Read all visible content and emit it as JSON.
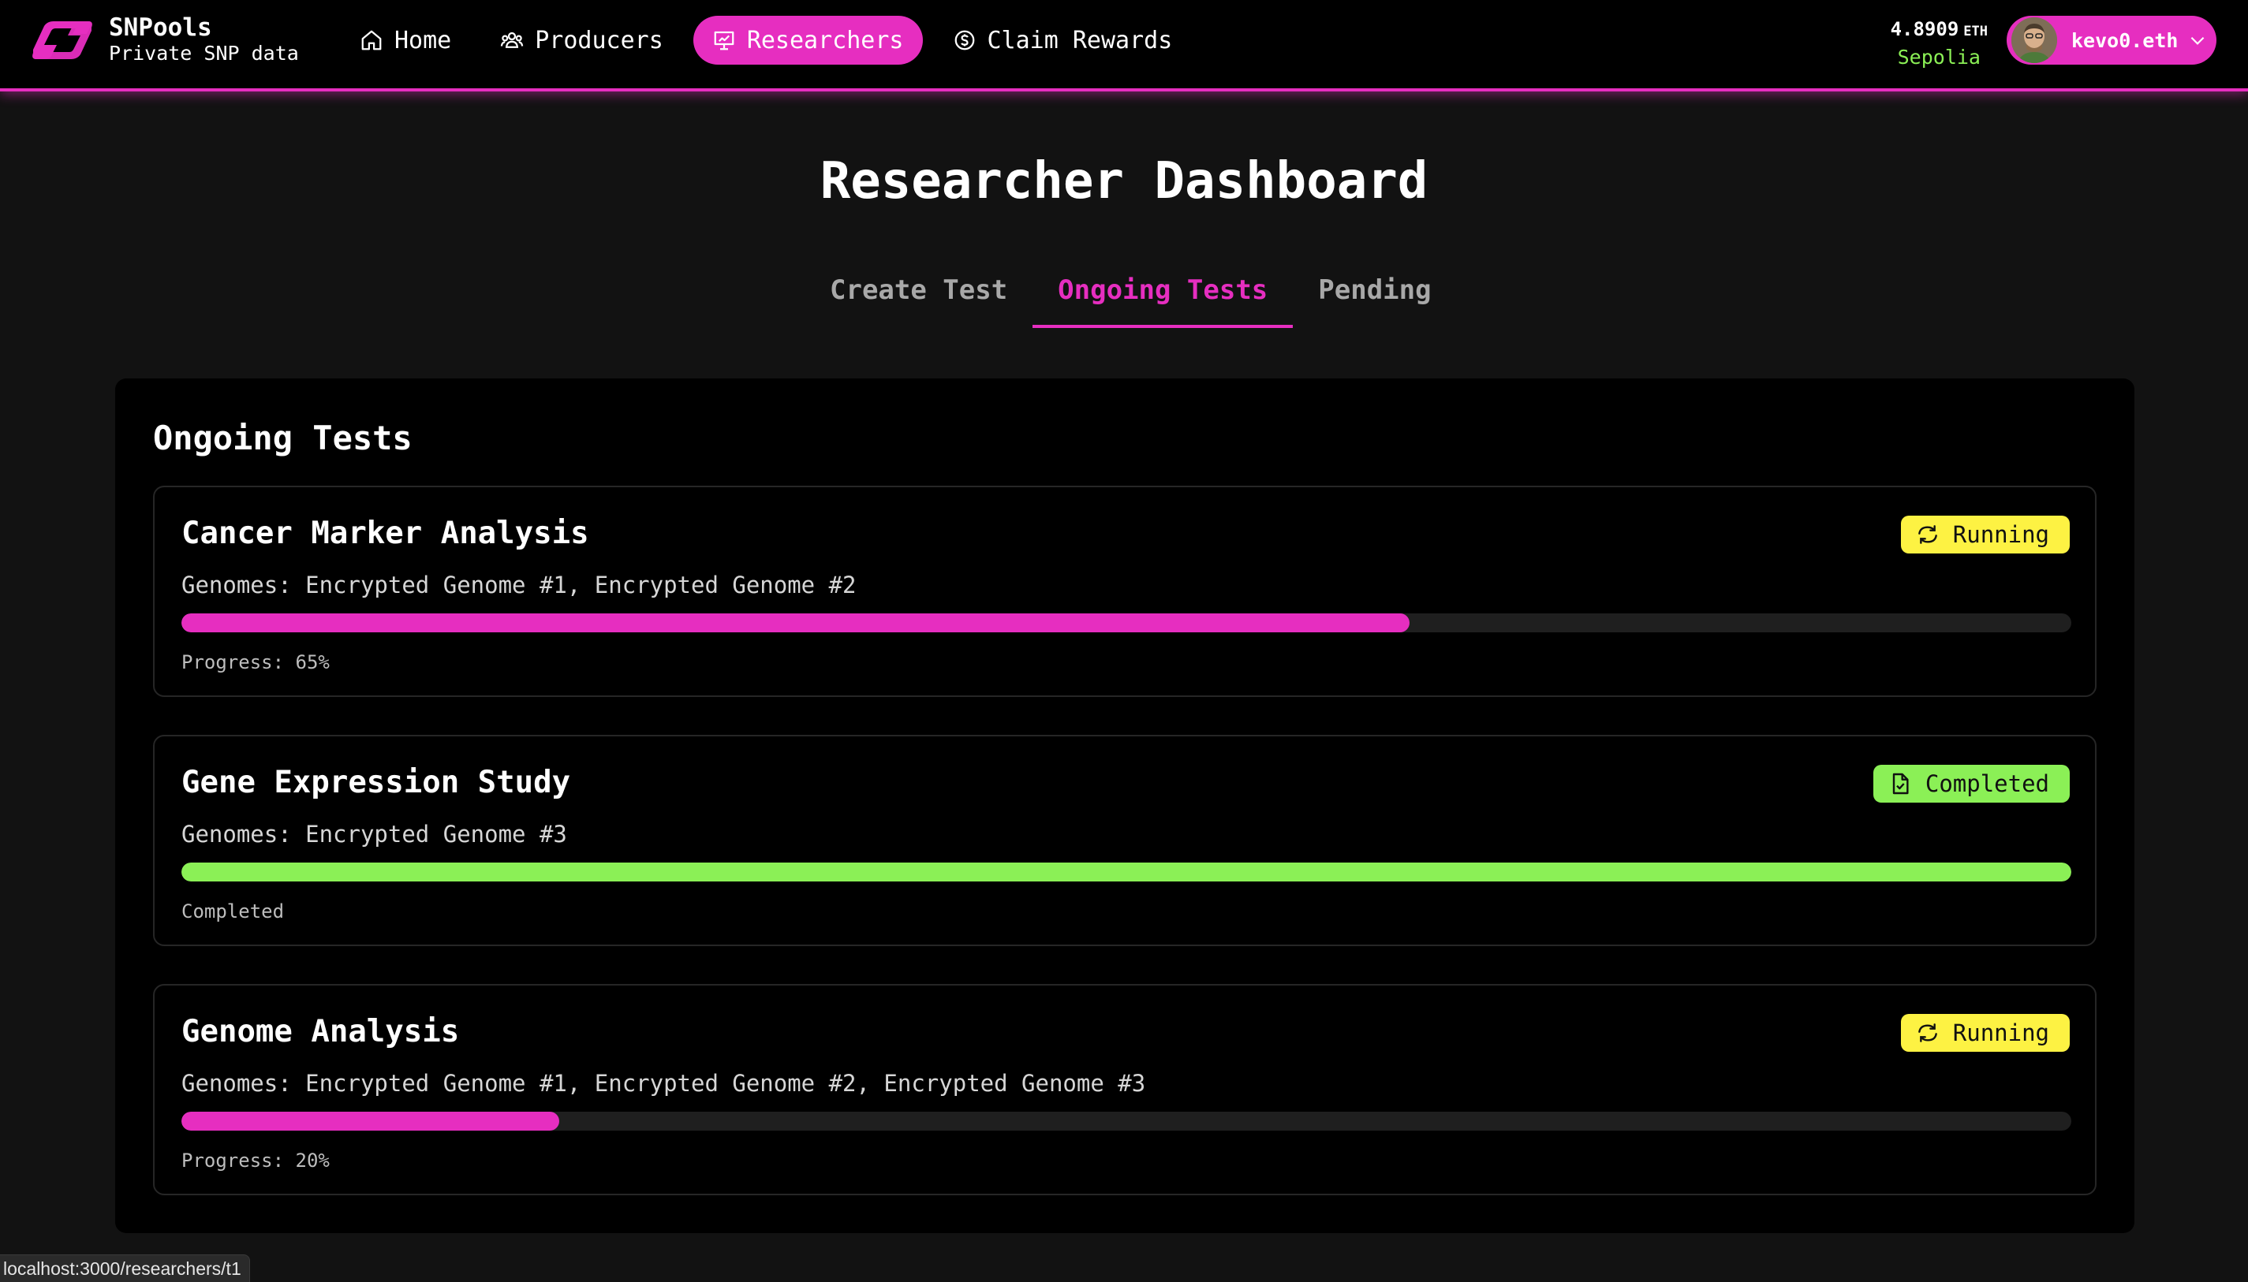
{
  "app": {
    "name": "SNPools",
    "tagline": "Private SNP data",
    "accent": "#e62ec0",
    "success": "#8bf056",
    "warning": "#fdf243"
  },
  "nav": {
    "items": [
      {
        "label": "Home",
        "icon": "home-icon",
        "active": false
      },
      {
        "label": "Producers",
        "icon": "users-icon",
        "active": false
      },
      {
        "label": "Researchers",
        "icon": "presentation-chart-icon",
        "active": true
      },
      {
        "label": "Claim Rewards",
        "icon": "dollar-circle-icon",
        "active": false
      }
    ]
  },
  "wallet": {
    "balance": "4.8909",
    "unit": "ETH",
    "network": "Sepolia",
    "account": "kevo0.eth"
  },
  "page": {
    "title": "Researcher Dashboard",
    "tabs": [
      {
        "label": "Create Test",
        "active": false
      },
      {
        "label": "Ongoing Tests",
        "active": true
      },
      {
        "label": "Pending",
        "active": false
      }
    ]
  },
  "ongoing": {
    "title": "Ongoing Tests",
    "tests": [
      {
        "name": "Cancer Marker Analysis",
        "genomes": "Genomes: Encrypted Genome #1, Encrypted Genome #2",
        "status": "Running",
        "status_icon": "refresh-icon",
        "progress": 65,
        "progress_text": "Progress: 65%"
      },
      {
        "name": "Gene Expression Study",
        "genomes": "Genomes: Encrypted Genome #3",
        "status": "Completed",
        "status_icon": "file-check-icon",
        "progress": 100,
        "progress_text": "Completed"
      },
      {
        "name": "Genome Analysis",
        "genomes": "Genomes: Encrypted Genome #1, Encrypted Genome #2, Encrypted Genome #3",
        "status": "Running",
        "status_icon": "refresh-icon",
        "progress": 20,
        "progress_text": "Progress: 20%"
      }
    ]
  },
  "statusbar": {
    "url": "localhost:3000/researchers/t1"
  }
}
